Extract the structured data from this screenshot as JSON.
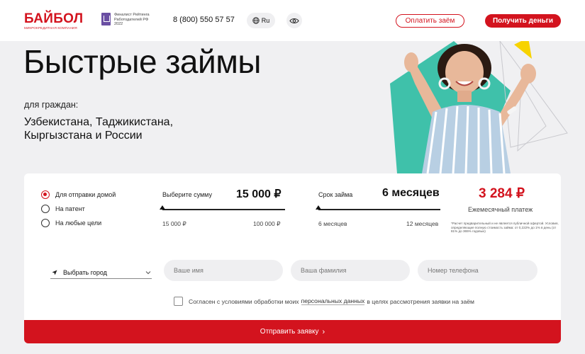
{
  "header": {
    "logo_main": "БАЙБОЛ",
    "logo_sub": "микрокредитная компания",
    "rating_text": "Финалист Рейтинга Работодателей РФ 2022",
    "phone": "8 (800) 550 57 57",
    "language": "Ru",
    "pay_button": "Оплатить заём",
    "get_money_button": "Получить деньги"
  },
  "hero": {
    "title": "Быстрые займы",
    "for_citizens": "для граждан:",
    "countries": "Узбекистана, Таджикистана, Кыргызстана и России"
  },
  "form": {
    "purposes": [
      {
        "label": "Для отправки домой",
        "selected": true
      },
      {
        "label": "На патент",
        "selected": false
      },
      {
        "label": "На любые цели",
        "selected": false
      }
    ],
    "amount": {
      "label": "Выберите сумму",
      "value": "15 000 ₽",
      "min": "15 000 ₽",
      "max": "100 000 ₽",
      "position": 0
    },
    "term": {
      "label": "Срок займа",
      "value": "6 месяцев",
      "min": "6 месяцев",
      "max": "12 месяцев",
      "position": 0
    },
    "monthly_payment_value": "3 284 ₽",
    "monthly_payment_label": "Ежемесячный платеж",
    "disclaimer": "*Расчет предварительный и не является публичной офертой. Условия, определяющие полную стоимость займа: от 0,222% до 1% в день (от 81% до 365% годовых)",
    "city_select": "Выбрать город",
    "name_placeholder": "Ваше имя",
    "surname_placeholder": "Ваша фамилия",
    "phone_placeholder": "Номер телефона",
    "consent_before": "Согласен с условиями обработки моих",
    "consent_link": "персональных данных",
    "consent_after": "в целях рассмотрения заявки на заём",
    "submit": "Отправить заявку"
  },
  "colors": {
    "brand_red": "#d3131e",
    "teal": "#3fc1aa",
    "yellow": "#f7d300",
    "background": "#f0f0f2"
  }
}
